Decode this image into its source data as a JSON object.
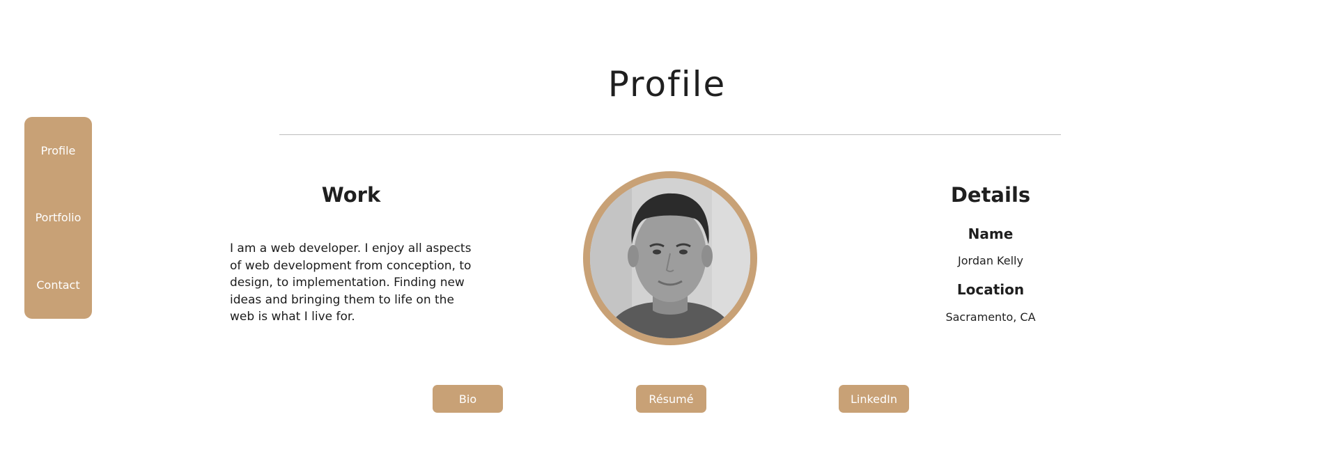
{
  "nav": {
    "items": [
      {
        "label": "Profile"
      },
      {
        "label": "Portfolio"
      },
      {
        "label": "Contact"
      }
    ]
  },
  "page": {
    "title": "Profile"
  },
  "work": {
    "heading": "Work",
    "text": "I am a web developer. I enjoy all aspects of web development from conception, to design, to implementation. Finding new ideas and bringing them to life on the web is what I live for."
  },
  "details": {
    "heading": "Details",
    "name_label": "Name",
    "name_value": "Jordan Kelly",
    "location_label": "Location",
    "location_value": "Sacramento, CA"
  },
  "buttons": {
    "bio": "Bio",
    "resume": "Résumé",
    "linkedin": "LinkedIn"
  },
  "colors": {
    "accent": "#c8a176",
    "text": "#1f1f1f",
    "divider": "#bdbdbd",
    "background": "#ffffff"
  }
}
